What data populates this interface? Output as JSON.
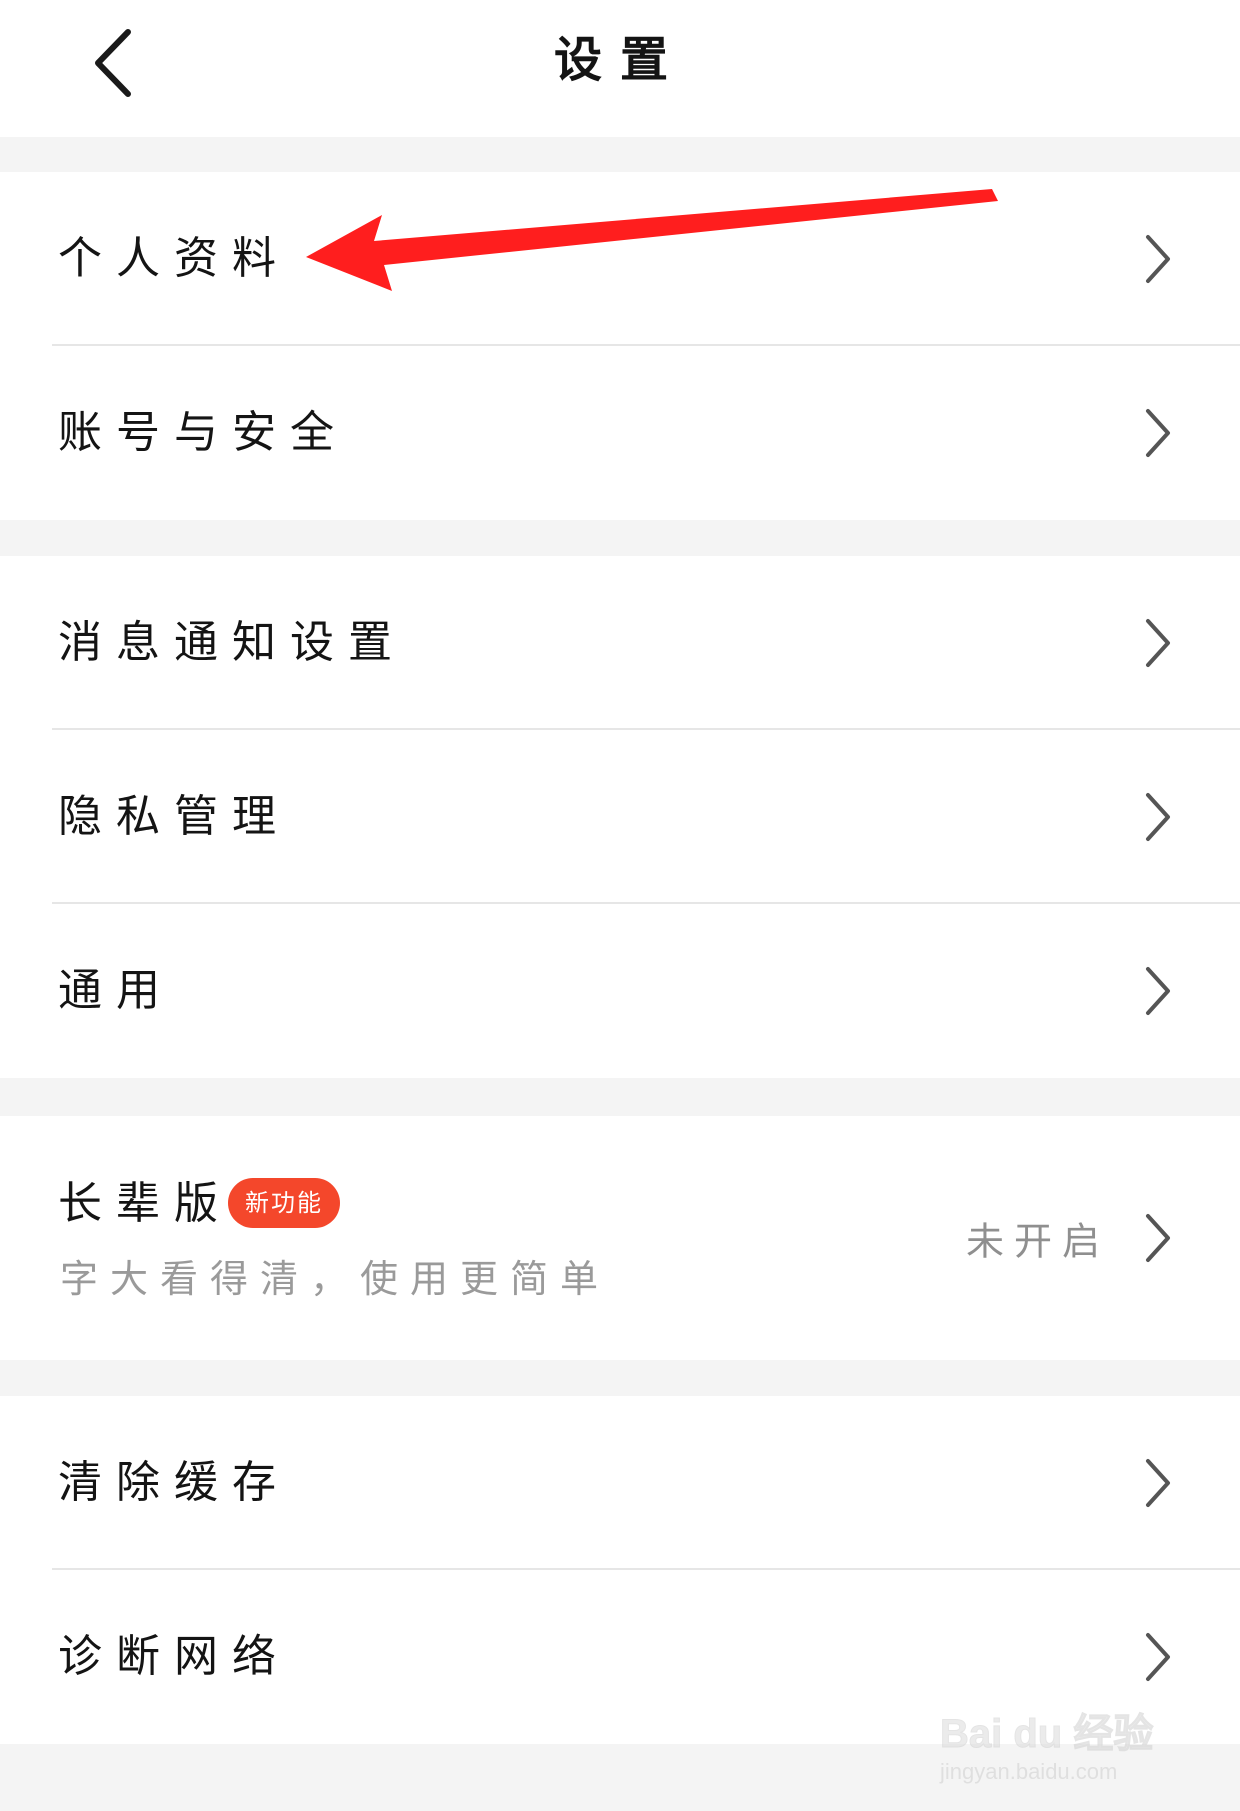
{
  "header": {
    "title": "设置"
  },
  "icons": {
    "back": "chevron-left-icon",
    "row_arrow": "chevron-right-icon"
  },
  "groups": [
    {
      "items": [
        {
          "label": "个人资料"
        },
        {
          "label": "账号与安全"
        }
      ]
    },
    {
      "items": [
        {
          "label": "消息通知设置"
        },
        {
          "label": "隐私管理"
        },
        {
          "label": "通用"
        }
      ]
    },
    {
      "items": [
        {
          "label": "长辈版",
          "badge": "新功能",
          "subtitle": "字大看得清，使用更简单",
          "status": "未开启"
        }
      ]
    },
    {
      "items": [
        {
          "label": "清除缓存"
        },
        {
          "label": "诊断网络"
        }
      ]
    }
  ],
  "watermark": {
    "main": "Bai du 经验",
    "sub": "jingyan.baidu.com"
  },
  "colors": {
    "background": "#f4f4f4",
    "surface": "#ffffff",
    "badge": "#f4472b",
    "annotation": "#ff1e1e",
    "muted_text": "#9a9a9a"
  }
}
